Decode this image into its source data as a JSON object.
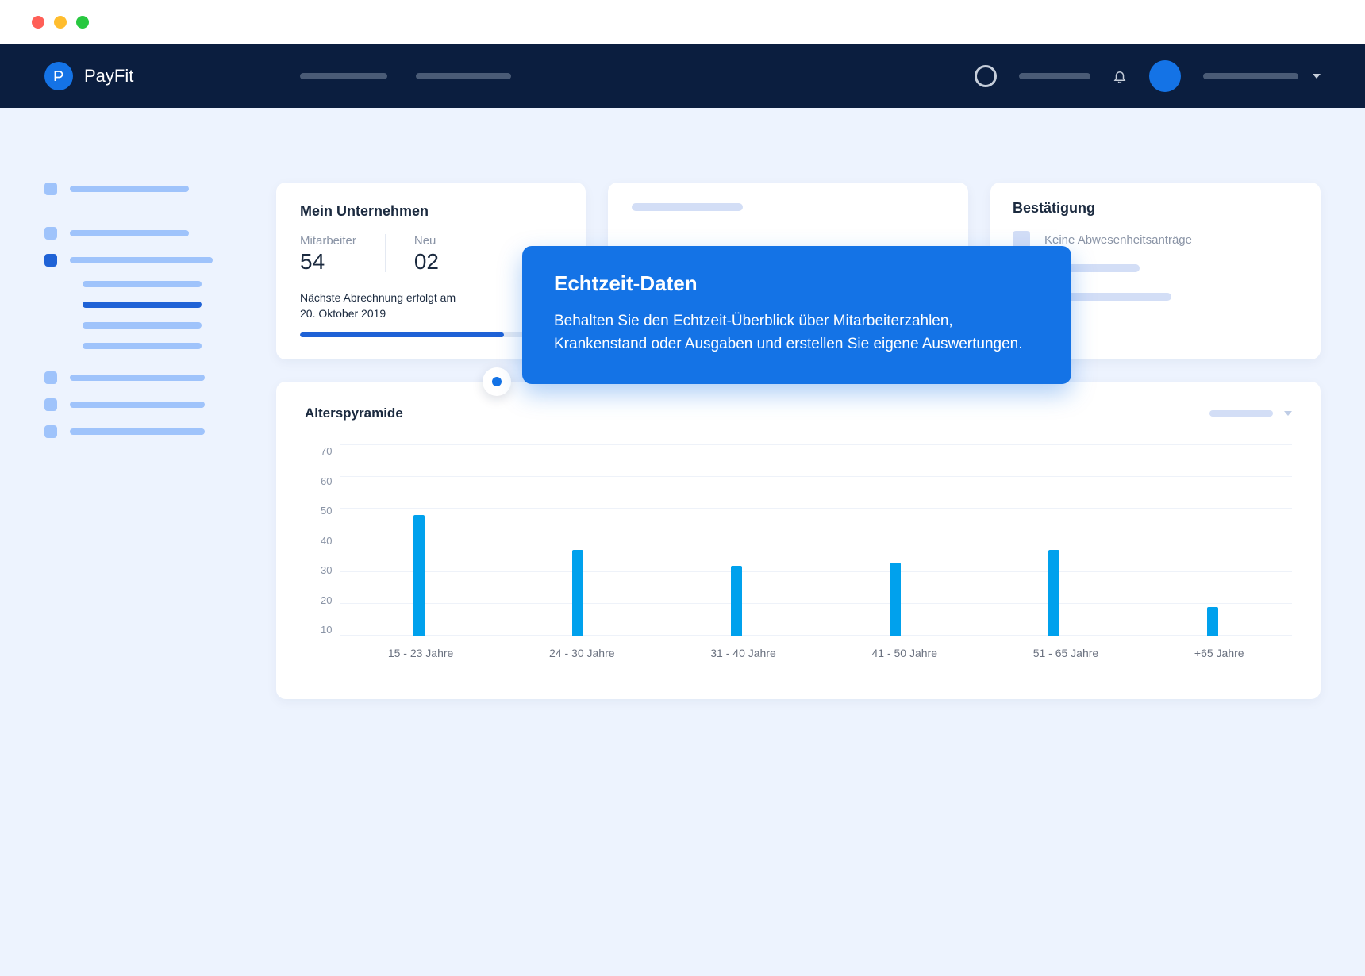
{
  "brand": {
    "name": "PayFit"
  },
  "company_card": {
    "title": "Mein Unternehmen",
    "employee_label": "Mitarbeiter",
    "employee_value": "54",
    "new_label": "Neu",
    "new_value": "02",
    "payroll_note_line1": "Nächste Abrechnung erfolgt am",
    "payroll_note_line2": "20. Oktober 2019",
    "progress_pct": 78
  },
  "confirm_card": {
    "title": "Bestätigung",
    "no_requests": "Keine Abwesenheitsanträge"
  },
  "callout": {
    "title": "Echtzeit-Daten",
    "body": "Behalten Sie den Echtzeit-Überblick über Mitarbeiterzahlen, Krankenstand oder Ausgaben und erstellen Sie eigene Auswertungen."
  },
  "chart_data": {
    "type": "bar",
    "title": "Alterspyramide",
    "y_ticks": [
      70,
      60,
      50,
      40,
      30,
      20,
      10
    ],
    "ymin": 10,
    "ymax": 70,
    "categories": [
      "15 - 23 Jahre",
      "24 - 30 Jahre",
      "31 - 40 Jahre",
      "41 - 50 Jahre",
      "51 - 65 Jahre",
      "+65 Jahre"
    ],
    "values": [
      48,
      37,
      32,
      33,
      37,
      19
    ]
  }
}
